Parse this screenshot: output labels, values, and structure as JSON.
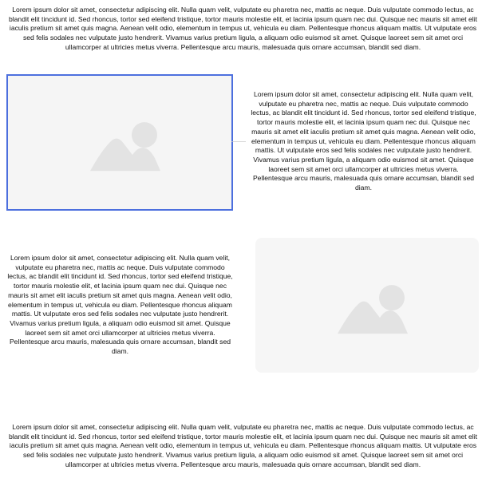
{
  "paragraphs": {
    "top": "Lorem ipsum dolor sit amet, consectetur adipiscing elit. Nulla quam velit, vulputate eu pharetra nec, mattis ac neque. Duis vulputate commodo lectus, ac blandit elit tincidunt id. Sed rhoncus, tortor sed eleifend tristique, tortor mauris molestie elit, et lacinia ipsum quam nec dui. Quisque nec mauris sit amet elit iaculis pretium sit amet quis magna. Aenean velit odio, elementum in tempus ut, vehicula eu diam. Pellentesque rhoncus aliquam mattis. Ut vulputate eros sed felis sodales nec vulputate justo hendrerit. Vivamus varius pretium ligula, a aliquam odio euismod sit amet. Quisque laoreet sem sit amet orci ullamcorper at ultricies metus viverra. Pellentesque arcu mauris, malesuada quis ornare accumsan, blandit sed diam.",
    "right": "Lorem ipsum dolor sit amet, consectetur adipiscing elit. Nulla quam velit, vulputate eu pharetra nec, mattis ac neque. Duis vulputate commodo lectus, ac blandit elit tincidunt id. Sed rhoncus, tortor sed eleifend tristique, tortor mauris molestie elit, et lacinia ipsum quam nec dui. Quisque nec mauris sit amet elit iaculis pretium sit amet quis magna. Aenean velit odio, elementum in tempus ut, vehicula eu diam. Pellentesque rhoncus aliquam mattis. Ut vulputate eros sed felis sodales nec vulputate justo hendrerit. Vivamus varius pretium ligula, a aliquam odio euismod sit amet. Quisque laoreet sem sit amet orci ullamcorper at ultricies metus viverra. Pellentesque arcu mauris, malesuada quis ornare accumsan, blandit sed diam.",
    "left": "Lorem ipsum dolor sit amet, consectetur adipiscing elit. Nulla quam velit, vulputate eu pharetra nec, mattis ac neque. Duis vulputate commodo lectus, ac blandit elit tincidunt id. Sed rhoncus, tortor sed eleifend tristique, tortor mauris molestie elit, et lacinia ipsum quam nec dui. Quisque nec mauris sit amet elit iaculis pretium sit amet quis magna. Aenean velit odio, elementum in tempus ut, vehicula eu diam. Pellentesque rhoncus aliquam mattis. Ut vulputate eros sed felis sodales nec vulputate justo hendrerit. Vivamus varius pretium ligula, a aliquam odio euismod sit amet. Quisque laoreet sem sit amet orci ullamcorper at ultricies metus viverra. Pellentesque arcu mauris, malesuada quis ornare accumsan, blandit sed diam.",
    "bottom": "Lorem ipsum dolor sit amet, consectetur adipiscing elit. Nulla quam velit, vulputate eu pharetra nec, mattis ac neque. Duis vulputate commodo lectus, ac blandit elit tincidunt id. Sed rhoncus, tortor sed eleifend tristique, tortor mauris molestie elit, et lacinia ipsum quam nec dui. Quisque nec mauris sit amet elit iaculis pretium sit amet quis magna. Aenean velit odio, elementum in tempus ut, vehicula eu diam. Pellentesque rhoncus aliquam mattis. Ut vulputate eros sed felis sodales nec vulputate justo hendrerit. Vivamus varius pretium ligula, a aliquam odio euismod sit amet. Quisque laoreet sem sit amet orci ullamcorper at ultricies metus viverra. Pellentesque arcu mauris, malesuada quis ornare accumsan, blandit sed diam."
  },
  "images": {
    "top_left": {
      "icon": "image-placeholder-icon",
      "selected": true
    },
    "bottom_right": {
      "icon": "image-placeholder-icon",
      "selected": false
    }
  },
  "colors": {
    "background": "#ffffff",
    "text": "#111111",
    "placeholder_background": "#f5f5f5",
    "placeholder_shape": "#e3e3e3",
    "selection_border": "#4c6fde"
  }
}
